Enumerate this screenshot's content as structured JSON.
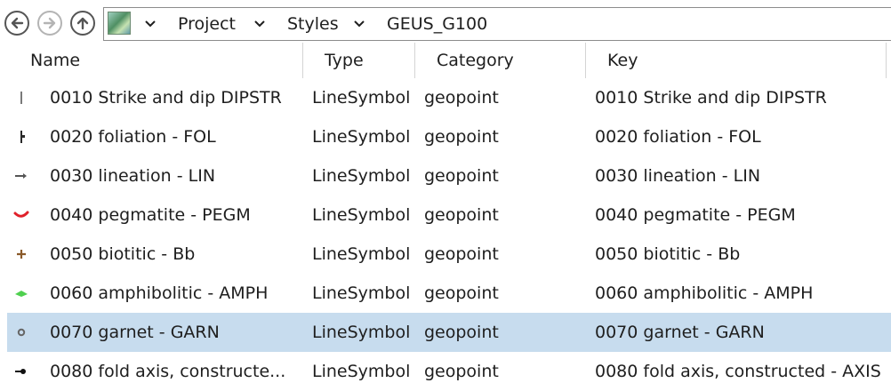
{
  "nav": {
    "back_icon": "back-arrow-icon",
    "forward_icon": "forward-arrow-icon",
    "up_icon": "up-arrow-icon"
  },
  "breadcrumb": {
    "items": [
      "Project",
      "Styles",
      "GEUS_G100"
    ]
  },
  "columns": [
    "Name",
    "Type",
    "Category",
    "Key"
  ],
  "rows": [
    {
      "name": "0010 Strike and dip DIPSTR",
      "type": "LineSymbol",
      "category": "geopoint",
      "key": "0010 Strike and dip DIPSTR",
      "icon": "strike-dip-symbol-icon",
      "color": "#7a7a7a"
    },
    {
      "name": "0020  foliation - FOL",
      "type": "LineSymbol",
      "category": "geopoint",
      "key": "0020  foliation - FOL",
      "icon": "foliation-symbol-icon",
      "color": "#2a2a2a"
    },
    {
      "name": "0030  lineation - LIN",
      "type": "LineSymbol",
      "category": "geopoint",
      "key": "0030  lineation - LIN",
      "icon": "lineation-symbol-icon",
      "color": "#555555"
    },
    {
      "name": "0040  pegmatite - PEGM",
      "type": "LineSymbol",
      "category": "geopoint",
      "key": "0040  pegmatite - PEGM",
      "icon": "pegmatite-symbol-icon",
      "color": "#e0202a"
    },
    {
      "name": "0050  biotitic - Bb",
      "type": "LineSymbol",
      "category": "geopoint",
      "key": "0050  biotitic - Bb",
      "icon": "biotitic-symbol-icon",
      "color": "#8a5a2a"
    },
    {
      "name": "0060 amphibolitic - AMPH",
      "type": "LineSymbol",
      "category": "geopoint",
      "key": "0060 amphibolitic - AMPH",
      "icon": "amphibolitic-symbol-icon",
      "color": "#4fd04f"
    },
    {
      "name": "0070  garnet - GARN",
      "type": "LineSymbol",
      "category": "geopoint",
      "key": "0070  garnet - GARN",
      "icon": "garnet-symbol-icon",
      "color": "#666666",
      "selected": true
    },
    {
      "name": "0080  fold axis, constructe...",
      "type": "LineSymbol",
      "category": "geopoint",
      "key": "0080  fold axis, constructed - AXIS",
      "icon": "fold-axis-symbol-icon",
      "color": "#111111"
    }
  ],
  "colors": {
    "selection": "#c7dcee",
    "border": "#8c8c8c"
  }
}
